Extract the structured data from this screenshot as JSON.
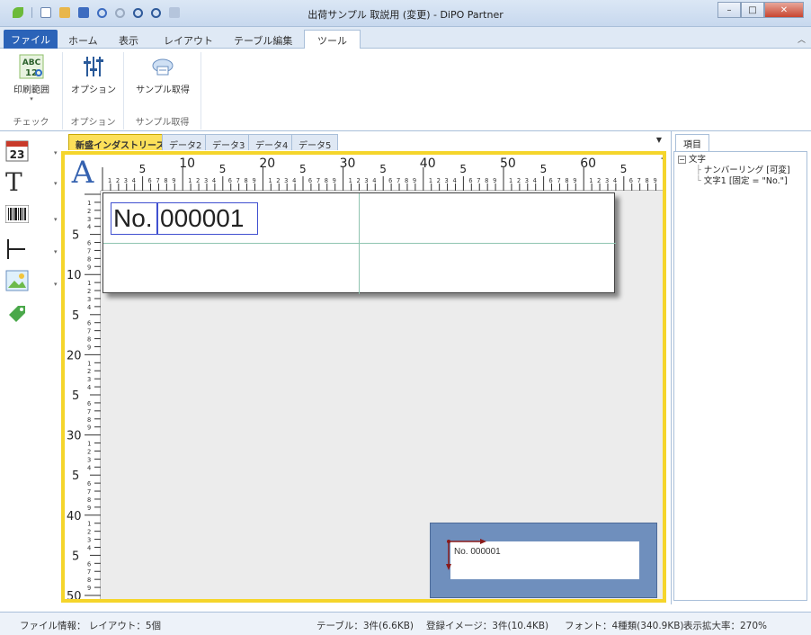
{
  "window": {
    "title": "出荷サンプル 取説用 (変更) - DiPO Partner",
    "minimize": "–",
    "maximize": "□",
    "close": "✕"
  },
  "ribbon_tabs": [
    "ファイル",
    "ホーム",
    "表示",
    "レイアウト",
    "テーブル編集",
    "ツール"
  ],
  "ribbon_groups": [
    {
      "label": "チェック",
      "button": "印刷範囲"
    },
    {
      "label": "オプション",
      "button": "オプション"
    },
    {
      "label": "サンプル取得",
      "button": "サンプル取得"
    }
  ],
  "left_tools": {
    "date_number": "23",
    "text_glyph": "T"
  },
  "doc_tabs": [
    "新盛インダストリーズ",
    "データ2",
    "データ3",
    "データ4",
    "データ5"
  ],
  "canvas": {
    "corner": "A",
    "ruler_top": [
      "5",
      "10",
      "5",
      "20",
      "5",
      "30",
      "5",
      "40",
      "5",
      "50",
      "5",
      "60",
      "5",
      "70"
    ],
    "ruler_left": [
      "5",
      "10",
      "5",
      "20",
      "5",
      "30",
      "5",
      "40",
      "5",
      "50"
    ],
    "label_prefix": "No.",
    "label_number": "000001",
    "preview_text": "No. 000001"
  },
  "panel": {
    "tab": "項目",
    "tree_root": "文字",
    "tree_items": [
      "ナンバーリング [可変]",
      "文字1 [固定 = \"No.\"]"
    ]
  },
  "status": {
    "file_info": "ファイル情報： レイアウト：5個",
    "table": "テーブル：3件(6.6KB)",
    "images": "登録イメージ：3件(10.4KB)",
    "fonts": "フォント：4種類(340.9KB)",
    "zoom": "表示拡大率：270%"
  }
}
